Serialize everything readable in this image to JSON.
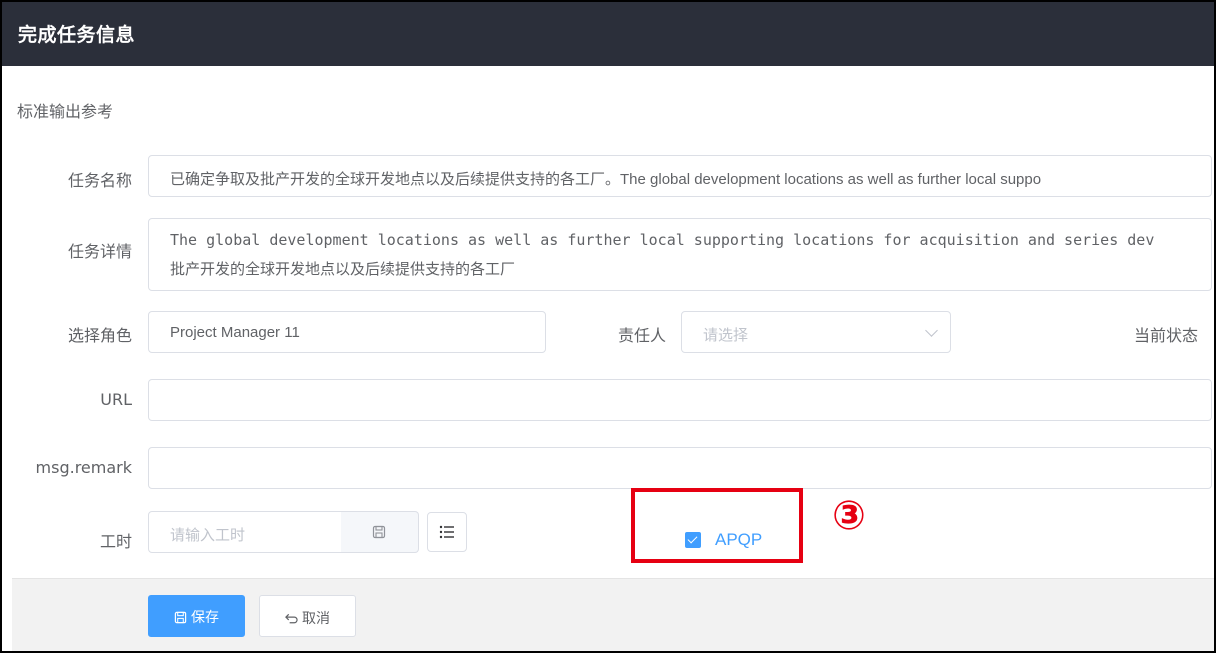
{
  "dialog": {
    "title": "完成任务信息"
  },
  "section": {
    "label": "标准输出参考"
  },
  "form": {
    "task_name_label": "任务名称",
    "task_name_value": "已确定争取及批产开发的全球开发地点以及后续提供支持的各工厂。The global development  locations as well as further local suppo",
    "task_detail_label": "任务详情",
    "task_detail_lines": [
      "The global development  locations as well as further local supporting locations for acquisition and series dev",
      "批产开发的全球开发地点以及后续提供支持的各工厂"
    ],
    "role_label": "选择角色",
    "role_value": "Project Manager 11",
    "owner_label": "责任人",
    "owner_placeholder": "请选择",
    "status_label": "当前状态",
    "url_label": "URL",
    "url_value": "",
    "remark_label": "msg.remark",
    "remark_value": "",
    "hours_label": "工时",
    "hours_placeholder": "请输入工时",
    "apqp_label": "APQP",
    "apqp_checked": true
  },
  "annotation": {
    "marker": "③",
    "color": "#e60012"
  },
  "footer": {
    "save_label": "保存",
    "cancel_label": "取消"
  },
  "colors": {
    "header_bg": "#2b2f3a",
    "primary": "#409eff",
    "border": "#dcdfe6",
    "highlight": "#e60012"
  }
}
